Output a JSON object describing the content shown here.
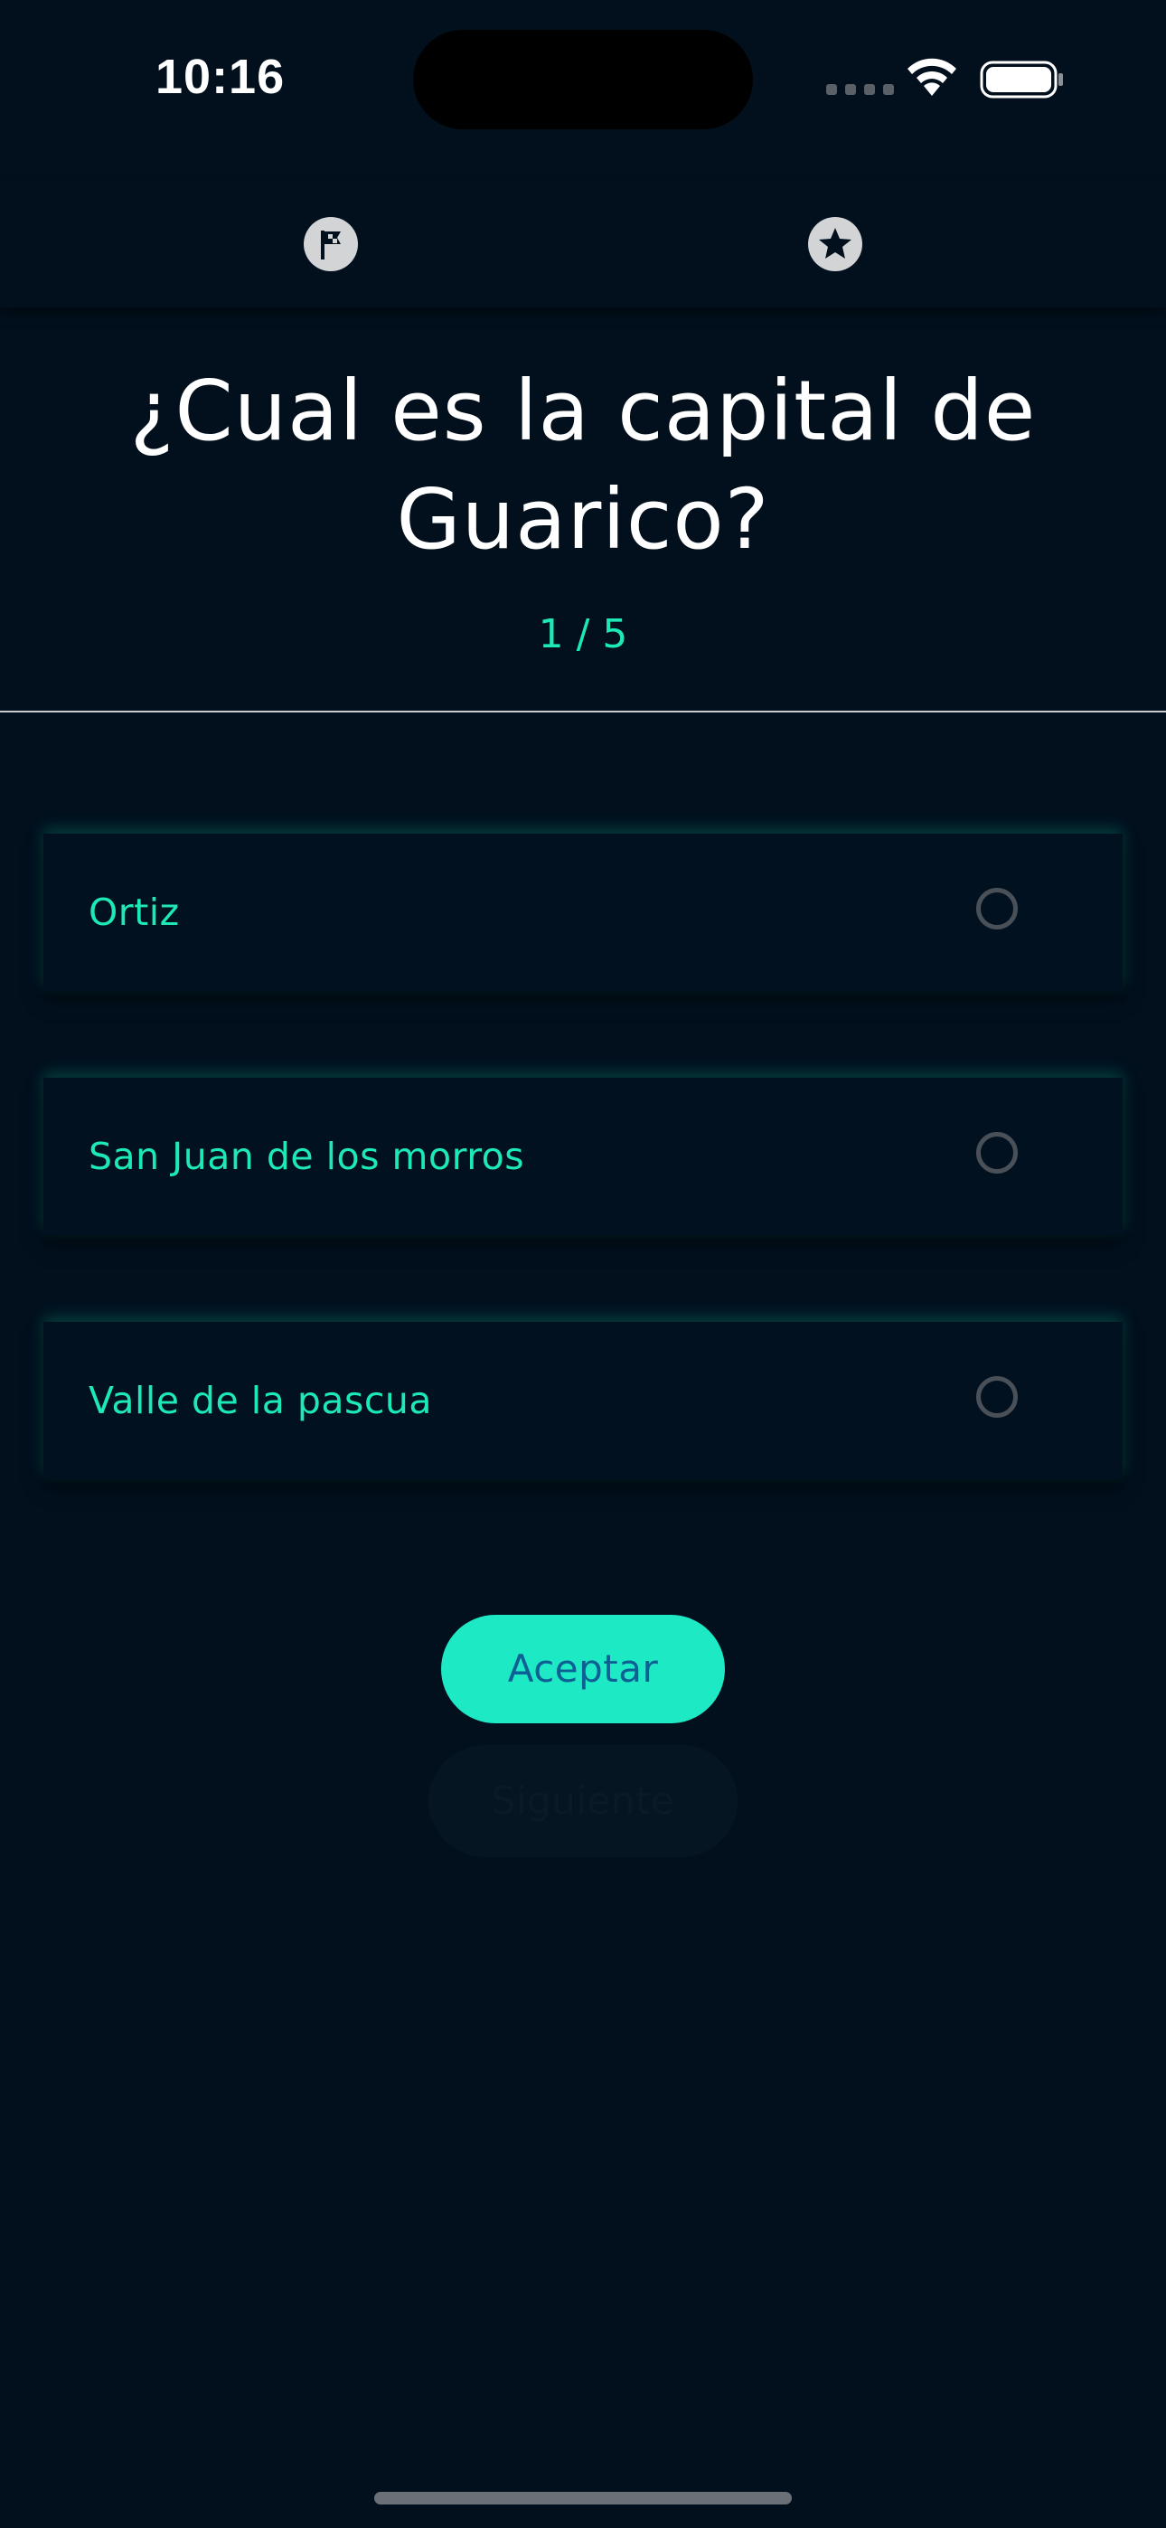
{
  "status_bar": {
    "time": "10:16"
  },
  "tabs": [
    {
      "icon": "flag-icon"
    },
    {
      "icon": "star-icon"
    }
  ],
  "question": {
    "text": "¿Cual es la capital de Guarico?",
    "progress": "1 / 5"
  },
  "options": [
    {
      "label": "Ortiz",
      "selected": false
    },
    {
      "label": "San Juan de los morros",
      "selected": false
    },
    {
      "label": "Valle de la pascua",
      "selected": false
    }
  ],
  "buttons": {
    "accept_label": "Aceptar",
    "next_label": "Siguiente"
  },
  "colors": {
    "background": "#02101e",
    "accent": "#1de9b6",
    "accept_button": "#1de9c5",
    "accept_text": "#0e5f93"
  }
}
